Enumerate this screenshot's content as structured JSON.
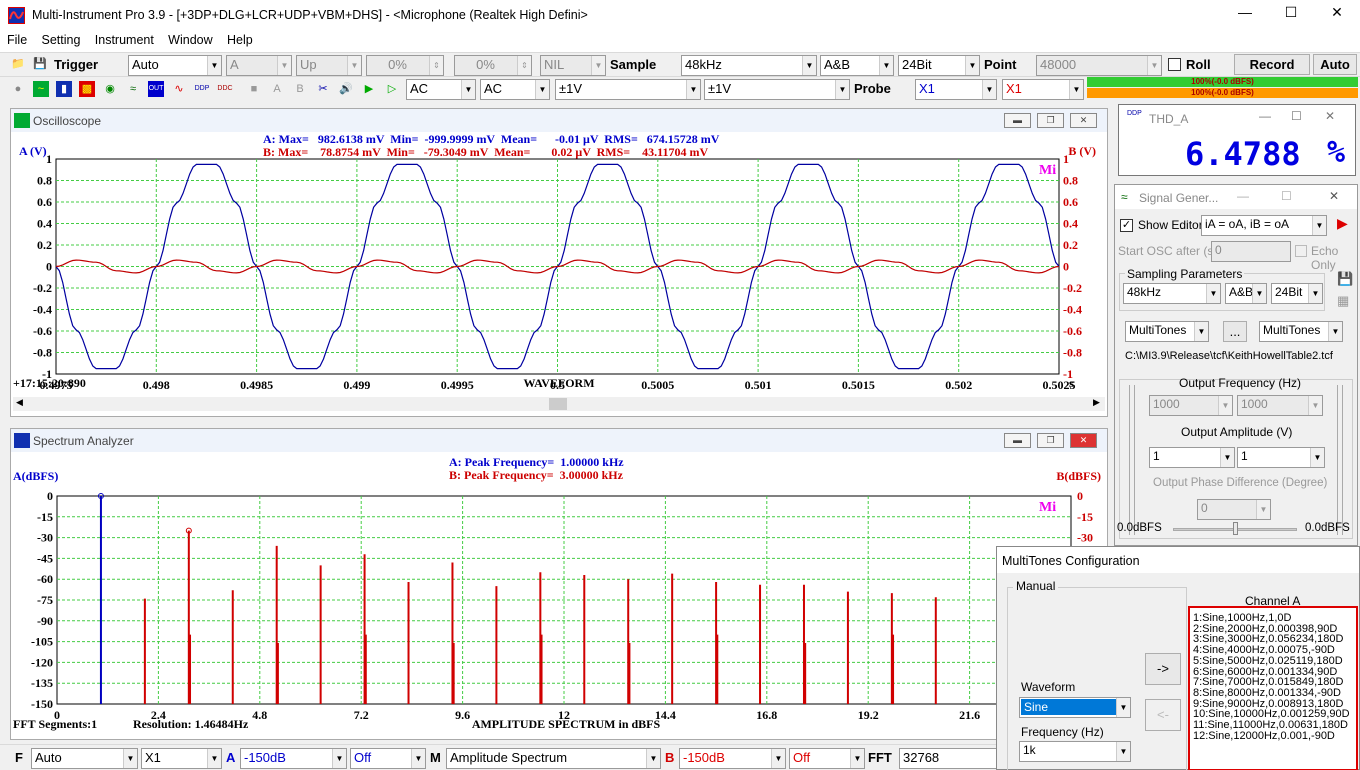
{
  "window": {
    "title": "Multi-Instrument Pro 3.9   -   [+3DP+DLG+LCR+UDP+VBM+DHS]   -   <Microphone (Realtek High Defini>"
  },
  "menu": [
    "File",
    "Setting",
    "Instrument",
    "Window",
    "Help"
  ],
  "toolbar1": {
    "trigger_label": "Trigger",
    "trigger_mode": "Auto",
    "trigger_source": "A",
    "trigger_edge": "Up",
    "trigger_level": "0%",
    "trigger_delay": "0%",
    "trigger_nil": "NIL",
    "sample_label": "Sample",
    "sample_rate": "48kHz",
    "channels": "A&B",
    "bits": "24Bit",
    "point_label": "Point",
    "points": "48000",
    "roll_label": "Roll",
    "record_label": "Record",
    "auto_label": "Auto",
    "level_a": "100%(-0.0 dBFS)",
    "level_b": "100%(-0.0 dBFS)"
  },
  "toolbar2": {
    "coupling_a": "AC",
    "coupling_b": "AC",
    "range_a": "±1V",
    "range_b": "±1V",
    "probe_label": "Probe",
    "probe_a": "X1",
    "probe_b": "X1"
  },
  "oscilloscope": {
    "title": "Oscilloscope",
    "a_label": "A (V)",
    "b_label": "B (V)",
    "stat_a": "A: Max=   982.6138 mV  Min=  -999.9999 mV  Mean=      -0.01 μV  RMS=   674.15728 mV",
    "stat_b": "B: Max=    78.8754 mV  Min=   -79.3049 mV  Mean=       0.02 μV  RMS=    43.11704 mV",
    "timestamp": "+17:15:20:890",
    "xlabel": "WAVEFORM",
    "xunit": "s",
    "y_ticks_left": [
      "1",
      "0.8",
      "0.6",
      "0.4",
      "0.2",
      "0",
      "-0.2",
      "-0.4",
      "-0.6",
      "-0.8",
      "-1"
    ],
    "y_ticks_right": [
      "1",
      "0.8",
      "0.6",
      "0.4",
      "0.2",
      "0",
      "-0.2",
      "-0.4",
      "-0.6",
      "-0.8",
      "-1"
    ],
    "x_ticks": [
      "0.4975",
      "0.498",
      "0.4985",
      "0.499",
      "0.4995",
      "0.5",
      "0.5005",
      "0.501",
      "0.5015",
      "0.502",
      "0.5025"
    ],
    "logo": "Mi"
  },
  "chart_data": [
    {
      "type": "line",
      "x": [
        0.4975,
        0.4976,
        0.4977,
        0.4978,
        0.4979,
        0.498,
        0.4981,
        0.4982,
        0.4983,
        0.4984,
        0.4985,
        0.4986,
        0.4987,
        0.4988,
        0.4989,
        0.499,
        0.4991,
        0.4992,
        0.4993,
        0.4994,
        0.4995,
        0.4996,
        0.4997,
        0.4998,
        0.4999,
        0.5,
        0.5001,
        0.5002,
        0.5003,
        0.5004,
        0.5005,
        0.5006,
        0.5007,
        0.5008,
        0.5009,
        0.501,
        0.5011,
        0.5012,
        0.5013,
        0.5014,
        0.5015,
        0.5016,
        0.5017,
        0.5018,
        0.5019,
        0.502,
        0.5021,
        0.5022,
        0.5023,
        0.5024,
        0.5025
      ],
      "series": [
        {
          "name": "A",
          "color": "#0000a0",
          "values": [
            0.0,
            -0.59,
            -0.95,
            -0.95,
            -0.59,
            0.0,
            0.59,
            0.95,
            0.95,
            0.59,
            0.0,
            -0.59,
            -0.95,
            -0.95,
            -0.59,
            0.0,
            0.59,
            0.95,
            0.95,
            0.59,
            0.0,
            -0.59,
            -0.95,
            -0.95,
            -0.59,
            0.0,
            0.59,
            0.95,
            0.95,
            0.59,
            0.0,
            -0.59,
            -0.95,
            -0.95,
            -0.59,
            0.0,
            0.59,
            0.95,
            0.95,
            0.59,
            0.0,
            -0.59,
            -0.95,
            -0.95,
            -0.59,
            0.0,
            0.59,
            0.95,
            0.95,
            0.59,
            0.0
          ]
        },
        {
          "name": "B",
          "color": "#c00000",
          "values": [
            0.0,
            0.06,
            0.04,
            -0.04,
            -0.06,
            0.0,
            0.06,
            0.04,
            -0.04,
            -0.06,
            0.0,
            0.06,
            0.04,
            -0.04,
            -0.06,
            0.0,
            0.06,
            0.04,
            -0.04,
            -0.06,
            0.0,
            0.06,
            0.04,
            -0.04,
            -0.06,
            0.0,
            0.06,
            0.04,
            -0.04,
            -0.06,
            0.0,
            0.06,
            0.04,
            -0.04,
            -0.06,
            0.0,
            0.06,
            0.04,
            -0.04,
            -0.06,
            0.0,
            0.06,
            0.04,
            -0.04,
            -0.06,
            0.0,
            0.06,
            0.04,
            -0.04,
            -0.06,
            0.0
          ]
        }
      ],
      "xlim": [
        0.4975,
        0.5025
      ],
      "ylim": [
        -1,
        1
      ],
      "xlabel": "WAVEFORM",
      "grid": true
    },
    {
      "type": "bar",
      "x": [
        1,
        2,
        3,
        4,
        5,
        6,
        7,
        8,
        9,
        10,
        11,
        12,
        13,
        14,
        15,
        16,
        17,
        18,
        19,
        20
      ],
      "series": [
        {
          "name": "A",
          "color": "#0000c0",
          "values": [
            0,
            -150,
            -150,
            -150,
            -150,
            -150,
            -150,
            -150,
            -150,
            -150,
            -150,
            -150,
            -150,
            -150,
            -150,
            -150,
            -150,
            -150,
            -150,
            -150
          ]
        },
        {
          "name": "B",
          "color": "#d00000",
          "values": [
            -150,
            -74,
            -25,
            -68,
            -36,
            -50,
            -42,
            -62,
            -48,
            -65,
            -55,
            -57,
            -60,
            -56,
            -62,
            -64,
            -64,
            -69,
            -70,
            -73
          ]
        }
      ],
      "xlim": [
        0,
        24
      ],
      "ylim": [
        -150,
        0
      ],
      "xlabel": "AMPLITUDE SPECTRUM in dBFS",
      "grid": true
    }
  ],
  "spectrum": {
    "title": "Spectrum Analyzer",
    "a_label": "A(dBFS)",
    "b_label": "B(dBFS)",
    "peak_a": "A: Peak Frequency=  1.00000 kHz",
    "peak_b": "B: Peak Frequency=  3.00000 kHz",
    "segments": "FFT Segments:1",
    "resolution": "Resolution: 1.46484Hz",
    "xlabel": "AMPLITUDE SPECTRUM in dBFS",
    "y_ticks_left": [
      "0",
      "-15",
      "-30",
      "-45",
      "-60",
      "-75",
      "-90",
      "-105",
      "-120",
      "-135",
      "-150"
    ],
    "y_ticks_right": [
      "0",
      "-15",
      "-30"
    ],
    "x_ticks": [
      "0",
      "2.4",
      "4.8",
      "7.2",
      "9.6",
      "12",
      "14.4",
      "16.8",
      "19.2",
      "21.6"
    ],
    "logo": "Mi"
  },
  "bottombar": {
    "f_label": "F",
    "f_mode": "Auto",
    "f_mult": "X1",
    "a_label": "A",
    "a_floor": "-150dB",
    "a_off": "Off",
    "m_label": "M",
    "m_mode": "Amplitude Spectrum",
    "b_label": "B",
    "b_floor": "-150dB",
    "b_off": "Off",
    "fft_label": "FFT",
    "fft_size": "32768"
  },
  "thd": {
    "title": "THD_A",
    "value": "6.4788",
    "unit": "%"
  },
  "siggen": {
    "title": "Signal Gener...",
    "show_editor_label": "Show Editor",
    "show_editor_checked": true,
    "expr": "iA = oA, iB = oA",
    "start_osc_label": "Start OSC after (s)",
    "start_osc_value": "0",
    "echo_only_label": "Echo Only",
    "sampling_label": "Sampling Parameters",
    "rate": "48kHz",
    "channels": "A&B",
    "bits": "24Bit",
    "wave_a": "MultiTones",
    "more_button": "...",
    "wave_b": "MultiTones",
    "file_path": "C:\\MI3.9\\Release\\tcf\\KeithHowellTable2.tcf",
    "freq_label": "Output Frequency (Hz)",
    "freq_a": "1000",
    "freq_b": "1000",
    "amp_label": "Output Amplitude (V)",
    "amp_a": "1",
    "amp_b": "1",
    "phase_label": "Output Phase Difference (Degree)",
    "phase_value": "0",
    "dbfs_left": "0.0dBFS",
    "dbfs_right": "0.0dBFS"
  },
  "multitones": {
    "title": "MultiTones Configuration",
    "group_label": "Manual",
    "channel_label": "Channel A",
    "waveform_label": "Waveform",
    "waveform_value": "Sine",
    "frequency_label": "Frequency (Hz)",
    "frequency_value": "1k",
    "add_button": "->",
    "remove_button": "<-",
    "items": [
      "1:Sine,1000Hz,1,0D",
      "2:Sine,2000Hz,0.000398,90D",
      "3:Sine,3000Hz,0.056234,180D",
      "4:Sine,4000Hz,0.00075,-90D",
      "5:Sine,5000Hz,0.025119,180D",
      "6:Sine,6000Hz,0.001334,90D",
      "7:Sine,7000Hz,0.015849,180D",
      "8:Sine,8000Hz,0.001334,-90D",
      "9:Sine,9000Hz,0.008913,180D",
      "10:Sine,10000Hz,0.001259,90D",
      "11:Sine,11000Hz,0.00631,180D",
      "12:Sine,12000Hz,0.001,-90D"
    ]
  }
}
